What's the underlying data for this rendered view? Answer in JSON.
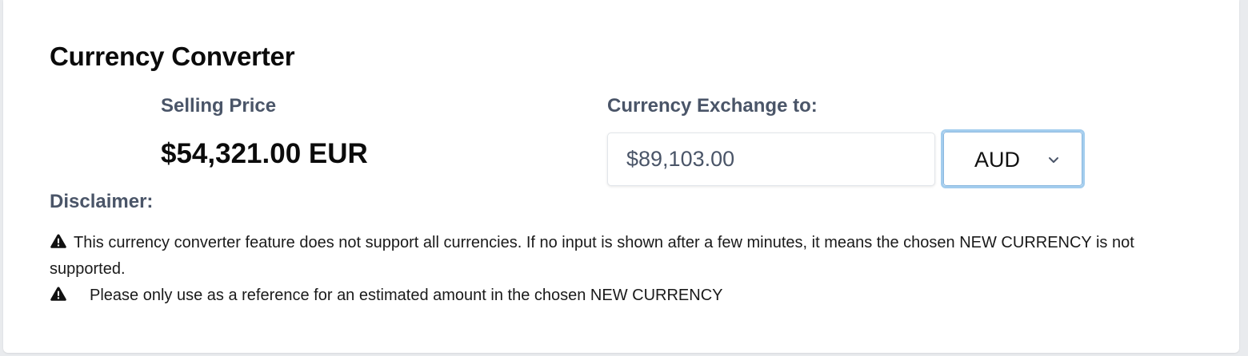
{
  "converter": {
    "title": "Currency Converter",
    "selling_price_label": "Selling Price",
    "selling_price_value": "$54,321.00 EUR",
    "exchange_label": "Currency Exchange to:",
    "converted_amount": "$89,103.00",
    "selected_currency": "AUD"
  },
  "disclaimer": {
    "label": "Disclaimer:",
    "notes": [
      "This currency converter feature does not support all currencies. If no input is shown after a few minutes, it means the chosen NEW CURRENCY is not supported.",
      "Please only use as a reference for an estimated amount in the chosen NEW CURRENCY"
    ]
  },
  "icons": {
    "warning": "warning-triangle-icon",
    "select": "chevron-down-icon"
  },
  "colors": {
    "label": "#4a5568",
    "select_focus_ring": "#a3cdee"
  }
}
